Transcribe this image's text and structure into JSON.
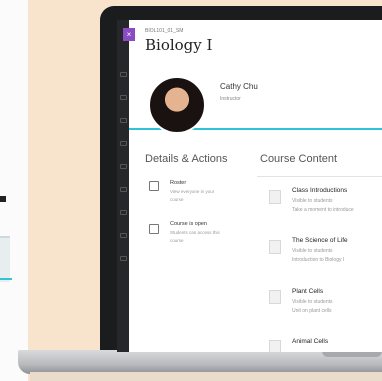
{
  "course": {
    "close_label": "×",
    "id": "BIOL101_01_SM",
    "title": "Biology I"
  },
  "instructor": {
    "name": "Cathy Chu",
    "role": "Instructor"
  },
  "details": {
    "heading": "Details & Actions",
    "items": [
      {
        "title": "Roster",
        "desc1": "View everyone in your",
        "desc2": "course",
        "icon": "roster-icon"
      },
      {
        "title": "Course is open",
        "desc1": "Students can access this",
        "desc2": "course",
        "icon": "open-course-icon"
      }
    ]
  },
  "content": {
    "heading": "Course Content",
    "items": [
      {
        "title": "Class Introductions",
        "desc1": "Visible to students",
        "desc2": "Take a moment to introduce",
        "icon": "discussion-icon"
      },
      {
        "title": "The Science of Life",
        "desc1": "Visible to students",
        "desc2": "Introduction to Biology I",
        "icon": "folder-icon"
      },
      {
        "title": "Plant Cells",
        "desc1": "Visible to students",
        "desc2": "Unit on plant cells",
        "icon": "folder-icon"
      },
      {
        "title": "Animal Cells",
        "desc1": "",
        "desc2": "",
        "icon": "folder-icon"
      }
    ]
  },
  "colors": {
    "accent": "#2ec4d6",
    "close_button": "#8a4bc4",
    "background": "#f8e4cd"
  }
}
